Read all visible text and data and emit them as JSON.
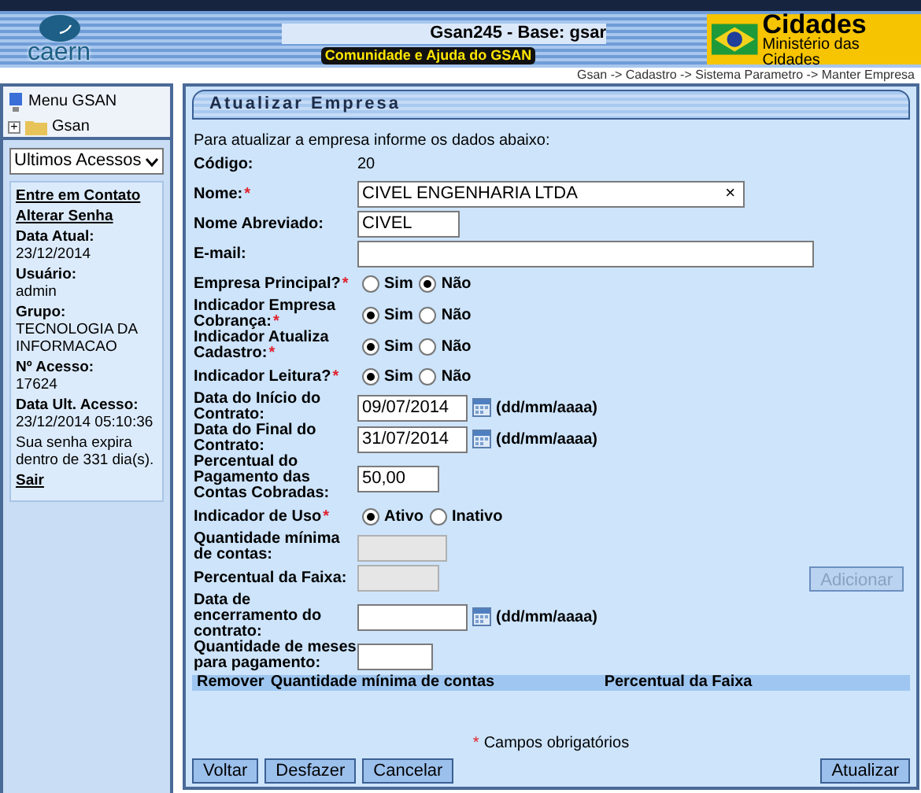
{
  "header": {
    "logo_text": "caern",
    "system_title": "Gsan245 - Base: gsar",
    "help_link": "Comunidade e Ajuda do GSAN",
    "ministry_title": "Cidades",
    "ministry_subtitle": "Ministério das Cidades",
    "breadcrumb": "Gsan -> Cadastro -> Sistema Parametro -> Manter Empresa"
  },
  "sidebar": {
    "menu_title": "Menu GSAN",
    "tree": [
      {
        "label": "Gsan",
        "toggle": "+"
      }
    ],
    "recent_select": "Ultimos Acessos",
    "links": [
      "Entre em Contato",
      "Alterar Senha"
    ],
    "info": [
      {
        "label": "Data Atual:",
        "value": "23/12/2014"
      },
      {
        "label": "Usuário:",
        "value": "admin"
      },
      {
        "label": "Grupo:",
        "value": "TECNOLOGIA DA INFORMACAO"
      },
      {
        "label": "Nº Acesso:",
        "value": "17624"
      },
      {
        "label": "Data Ult. Acesso:",
        "value": "23/12/2014 05:10:36"
      }
    ],
    "expiry_note": "Sua senha expira dentro de 331 dia(s).",
    "logout": "Sair"
  },
  "form": {
    "title": "Atualizar Empresa",
    "intro": "Para atualizar a empresa informe os dados abaixo:",
    "fields": [
      {
        "kind": "static",
        "label": "Código:",
        "value": "20"
      },
      {
        "kind": "input",
        "label": "Nome:",
        "required_mark": "*",
        "value": "CIVEL ENGENHARIA LTDA",
        "clear": "×"
      },
      {
        "kind": "input",
        "label": "Nome Abreviado:",
        "value": "CIVEL"
      },
      {
        "kind": "input",
        "label": "E-mail:"
      },
      {
        "kind": "radio",
        "label": "Empresa Principal?",
        "required_mark": "*",
        "options": [
          {
            "label": "Sim",
            "selected": false
          },
          {
            "label": "Não",
            "selected": true
          }
        ]
      },
      {
        "kind": "radio",
        "label": "Indicador Empresa Cobrança:",
        "required_mark": "*",
        "options": [
          {
            "label": "Sim",
            "selected": true
          },
          {
            "label": "Não",
            "selected": false
          }
        ]
      },
      {
        "kind": "radio",
        "label": "Indicador Atualiza Cadastro:",
        "required_mark": "*",
        "options": [
          {
            "label": "Sim",
            "selected": true
          },
          {
            "label": "Não",
            "selected": false
          }
        ]
      },
      {
        "kind": "radio",
        "label": "Indicador Leitura?",
        "required_mark": "*",
        "options": [
          {
            "label": "Sim",
            "selected": true
          },
          {
            "label": "Não",
            "selected": false
          }
        ]
      },
      {
        "kind": "date",
        "label": "Data do Início do Contrato:",
        "value": "09/07/2014",
        "hint": "(dd/mm/aaaa)"
      },
      {
        "kind": "date",
        "label": "Data do Final do Contrato:",
        "value": "31/07/2014",
        "hint": "(dd/mm/aaaa)"
      },
      {
        "kind": "input",
        "label": "Percentual do Pagamento das Contas Cobradas:",
        "value": "50,00"
      },
      {
        "kind": "radio",
        "label": "Indicador de Uso",
        "required_mark": "*",
        "options": [
          {
            "label": "Ativo",
            "selected": true
          },
          {
            "label": "Inativo",
            "selected": false
          }
        ]
      },
      {
        "kind": "input",
        "label": "Quantidade mínima de contas:",
        "disabled": true
      },
      {
        "kind": "input",
        "label": "Percentual da Faixa:",
        "disabled": true,
        "button": {
          "label": "Adicionar",
          "disabled": true
        }
      },
      {
        "kind": "date",
        "label": "Data de encerramento do contrato:",
        "hint": "(dd/mm/aaaa)"
      },
      {
        "kind": "input",
        "label": "Quantidade de meses para pagamento:"
      }
    ],
    "table_columns": [
      "Remover",
      "Quantidade mínima de contas",
      "Percentual da Faixa"
    ],
    "required_note": {
      "mark": "*",
      "text": "Campos obrigatórios"
    },
    "buttons_left": [
      "Voltar",
      "Desfazer",
      "Cancelar"
    ],
    "button_right": "Atualizar"
  }
}
